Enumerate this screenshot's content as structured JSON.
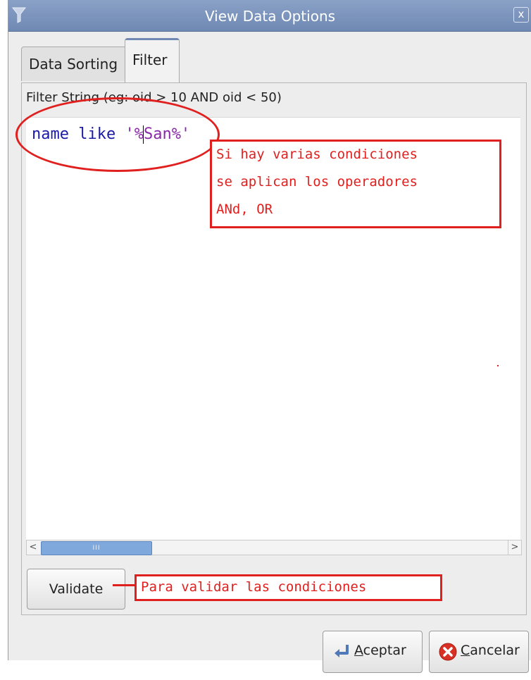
{
  "window": {
    "title": "View Data Options",
    "close_glyph": "x",
    "title_icon": "filter-funnel-icon"
  },
  "tabs": [
    {
      "label": "Data Sorting",
      "active": false
    },
    {
      "label": "Filter",
      "active": true
    }
  ],
  "filter": {
    "label": "Filter String (eg: oid > 10 AND oid < 50)",
    "code_keyword": "name like ",
    "code_string_before_cursor": "'%",
    "code_string_after_cursor": "San%'"
  },
  "scrollbar": {
    "left_arrow": "<",
    "right_arrow": ">",
    "thumb_grip": "III"
  },
  "buttons": {
    "validate": "Validate",
    "ok_underline": "A",
    "ok_rest": "ceptar",
    "cancel_underline": "C",
    "cancel_rest": "ancelar"
  },
  "annotations": {
    "conditions_lines": [
      "Si hay varias condiciones",
      "se aplican los  operadores",
      "ANd, OR"
    ],
    "validate_note": "Para validar las condiciones"
  },
  "colors": {
    "annotation_red": "#e0201e",
    "titlebar_blue": "#7a93bc",
    "code_keyword": "#1a1aa6",
    "code_string": "#8a2aa8"
  }
}
